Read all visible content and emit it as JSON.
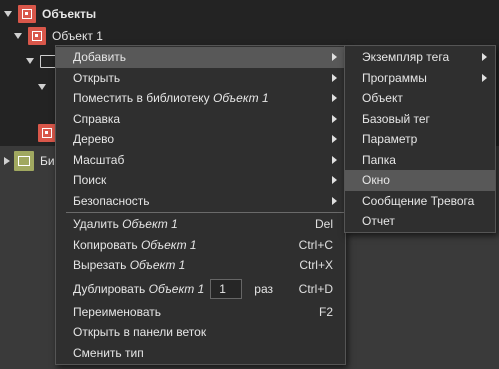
{
  "tree": {
    "root_label": "Объекты",
    "child_label": "Объект 1",
    "lib_label": "Би"
  },
  "context_menu": {
    "items": [
      {
        "label": "Добавить"
      },
      {
        "label": "Открыть"
      },
      {
        "label": "Поместить в библиотеку ",
        "italic": "Объект 1"
      },
      {
        "label": "Справка"
      },
      {
        "label": "Дерево"
      },
      {
        "label": "Масштаб"
      },
      {
        "label": "Поиск"
      },
      {
        "label": "Безопасность"
      },
      {
        "label": "Удалить ",
        "italic": "Объект 1",
        "shortcut": "Del"
      },
      {
        "label": "Копировать ",
        "italic": "Объект 1",
        "shortcut": "Ctrl+C"
      },
      {
        "label": "Вырезать ",
        "italic": "Объект 1",
        "shortcut": "Ctrl+X"
      },
      {
        "label": "Дублировать ",
        "italic": "Объект 1",
        "count": "1",
        "unit": "раз",
        "shortcut": "Ctrl+D"
      },
      {
        "label": "Переименовать",
        "shortcut": "F2"
      },
      {
        "label": "Открыть в панели веток"
      },
      {
        "label": "Сменить тип"
      }
    ]
  },
  "submenu": {
    "items": [
      {
        "label": "Экземпляр тега"
      },
      {
        "label": "Программы"
      },
      {
        "label": "Объект"
      },
      {
        "label": "Базовый тег"
      },
      {
        "label": "Параметр"
      },
      {
        "label": "Папка"
      },
      {
        "label": "Окно"
      },
      {
        "label": "Сообщение Тревога"
      },
      {
        "label": "Отчет"
      }
    ]
  },
  "colors": {
    "background": "#3a3a3a",
    "tree_background": "#232323",
    "menu_background": "#2f2f2f",
    "highlight": "#585858",
    "object_icon": "#d9574a",
    "library_icon": "#a0a860"
  }
}
